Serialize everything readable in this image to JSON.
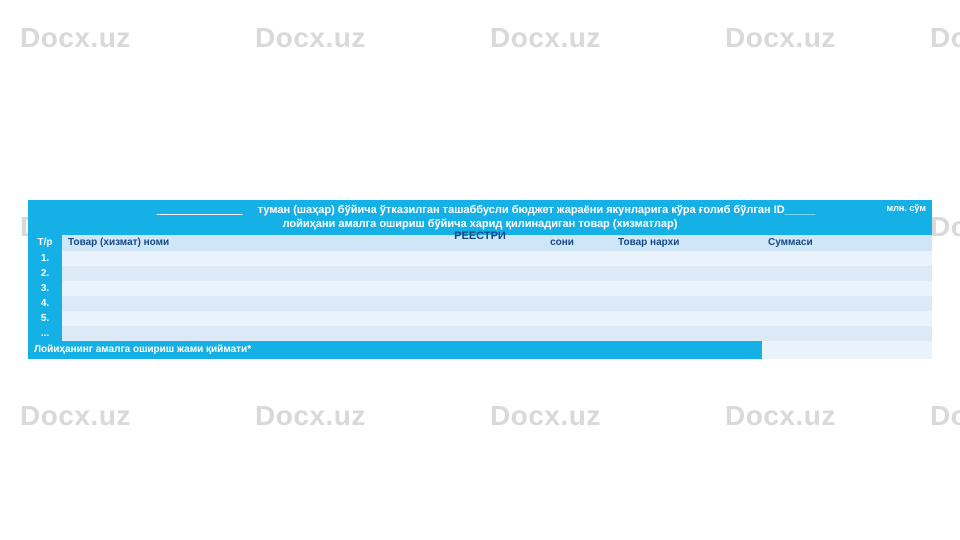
{
  "watermark": "Docx.uz",
  "title_prefix": "______________",
  "title_body": " туман (шаҳар) бўйича ўтказилган ташаббусли бюджет жараёни якунларига кўра ғолиб бўлган ID_____",
  "title_line2": "лойиҳани амалга ошириш бўйича харид қилинадиган товар (хизматлар)",
  "amount_unit": "млн. сўм",
  "subtitle": "РЕЕСТРИ",
  "headers": {
    "num": "Т/р",
    "name": "Товар (хизмат) номи",
    "unit": "сони",
    "price": "Товар нархи",
    "sum": "Суммаси"
  },
  "rows": [
    {
      "n": "1."
    },
    {
      "n": "2."
    },
    {
      "n": "3."
    },
    {
      "n": "4."
    },
    {
      "n": "5."
    },
    {
      "n": "..."
    }
  ],
  "total_label": "Лойиҳанинг амалга ошириш жами қиймати*"
}
